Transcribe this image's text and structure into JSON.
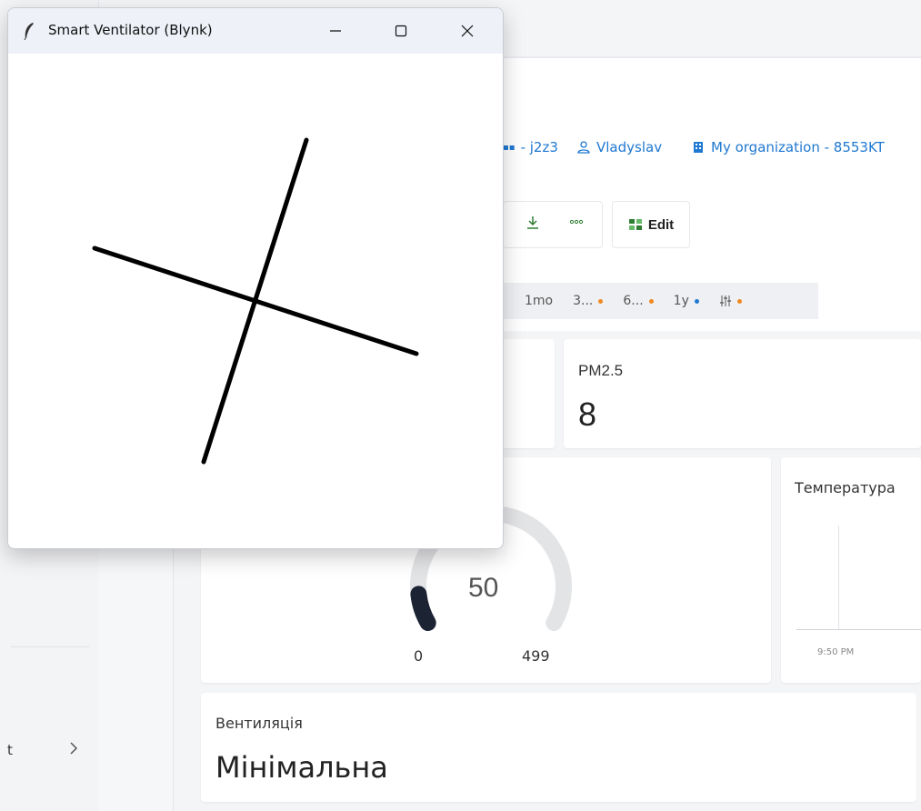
{
  "window": {
    "title": "Smart Ventilator (Blynk)"
  },
  "header": {
    "device_label": "- j2z3",
    "user_label": "Vladyslav",
    "organization_label": "My organization - 8553KT"
  },
  "toolbar": {
    "edit_label": "Edit"
  },
  "time_ranges": [
    {
      "label": "1mo",
      "dot": ""
    },
    {
      "label": "3...",
      "dot": "orange"
    },
    {
      "label": "6...",
      "dot": "orange"
    },
    {
      "label": "1y",
      "dot": "blue"
    }
  ],
  "widgets": {
    "pm25": {
      "title": "PM2.5",
      "value": "8"
    },
    "gauge": {
      "value": "50",
      "min": "0",
      "max": "499",
      "fraction": 0.1
    },
    "temperature": {
      "title": "Температура",
      "tick_label": "9:50 PM"
    },
    "ventilation": {
      "title": "Вентиляція",
      "value": "Мінімальна"
    }
  },
  "sidebar": {
    "item_text": "t"
  },
  "colors": {
    "accent_blue": "#1f78d1",
    "accent_orange": "#f0891f",
    "gauge_fill": "#1c2333",
    "gauge_track": "#e3e4e6"
  },
  "icons": {
    "app": "feather-icon",
    "minimize": "minimize-icon",
    "maximize": "maximize-icon",
    "close": "close-icon",
    "download": "download-icon",
    "more": "more-icon",
    "edit": "edit-icon",
    "user": "user-icon",
    "organization": "building-icon",
    "filter": "sliders-icon",
    "chevron": "chevron-right-icon"
  }
}
